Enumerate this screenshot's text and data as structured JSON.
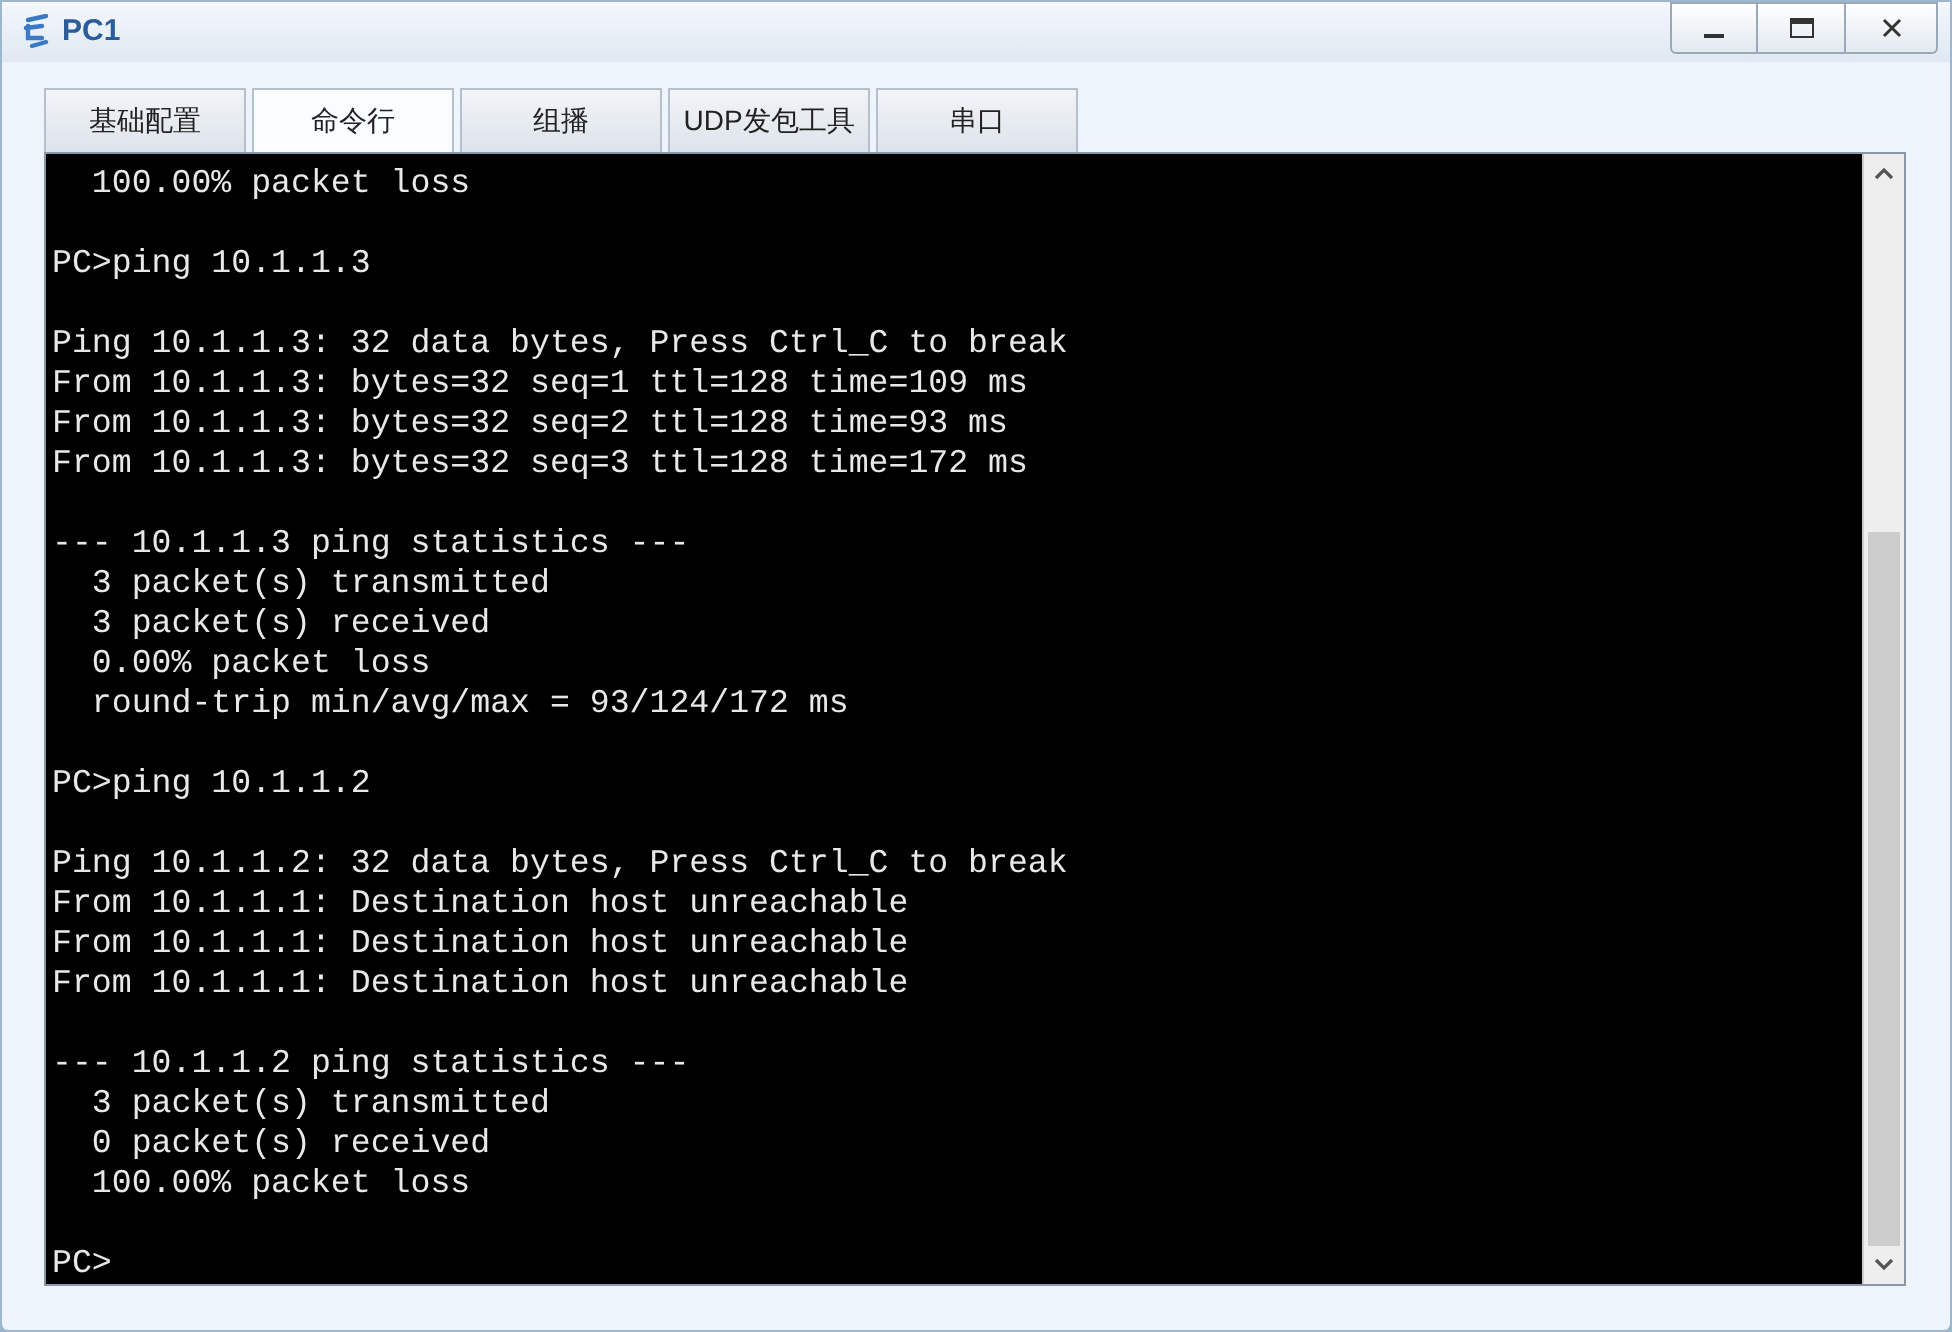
{
  "window": {
    "title": "PC1"
  },
  "tabs": [
    {
      "label": "基础配置",
      "selected": false
    },
    {
      "label": "命令行",
      "selected": true
    },
    {
      "label": "组播",
      "selected": false
    },
    {
      "label": "UDP发包工具",
      "selected": false
    },
    {
      "label": "串口",
      "selected": false
    }
  ],
  "terminal": {
    "blocks": [
      [
        "  100.00% packet loss"
      ],
      [
        "PC>ping 10.1.1.3"
      ],
      [
        "Ping 10.1.1.3: 32 data bytes, Press Ctrl_C to break",
        "From 10.1.1.3: bytes=32 seq=1 ttl=128 time=109 ms",
        "From 10.1.1.3: bytes=32 seq=2 ttl=128 time=93 ms",
        "From 10.1.1.3: bytes=32 seq=3 ttl=128 time=172 ms"
      ],
      [
        "--- 10.1.1.3 ping statistics ---",
        "  3 packet(s) transmitted",
        "  3 packet(s) received",
        "  0.00% packet loss",
        "  round-trip min/avg/max = 93/124/172 ms"
      ],
      [
        "PC>ping 10.1.1.2"
      ],
      [
        "Ping 10.1.1.2: 32 data bytes, Press Ctrl_C to break",
        "From 10.1.1.1: Destination host unreachable",
        "From 10.1.1.1: Destination host unreachable",
        "From 10.1.1.1: Destination host unreachable"
      ],
      [
        "--- 10.1.1.2 ping statistics ---",
        "  3 packet(s) transmitted",
        "  0 packet(s) received",
        "  100.00% packet loss"
      ],
      [
        "PC>"
      ]
    ]
  }
}
